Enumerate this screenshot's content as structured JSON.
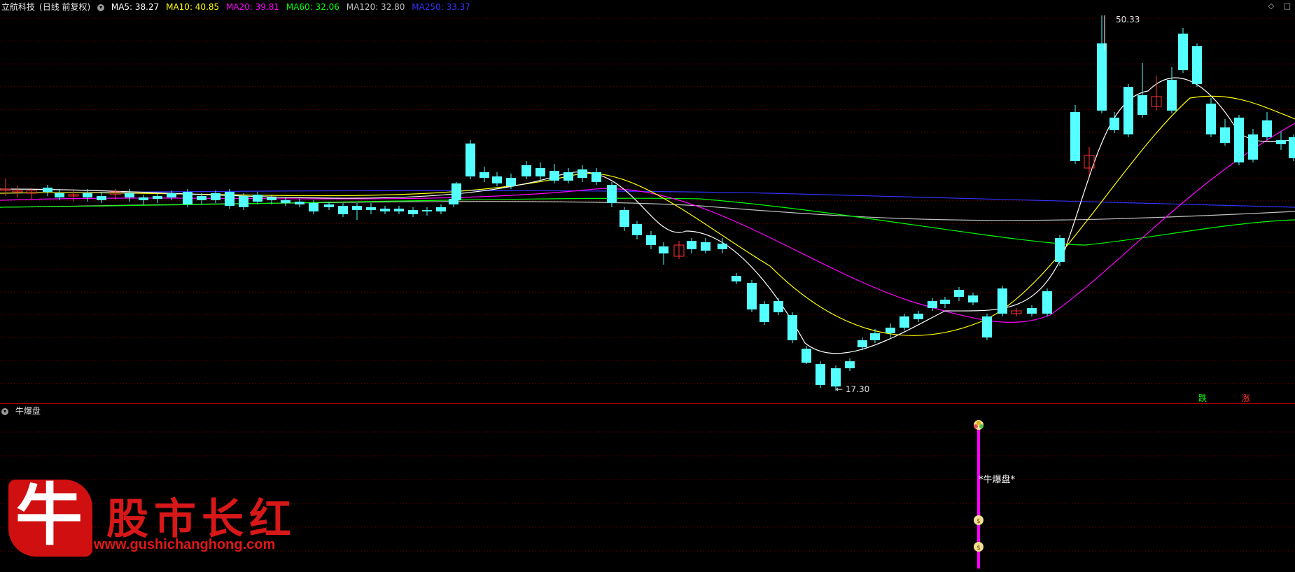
{
  "main_panel": {
    "stock_name": "立航科技",
    "period_label": "(日线 前复权)",
    "ma_indicators": [
      {
        "label": "MA5: 38.27",
        "color": "#ffffff"
      },
      {
        "label": "MA10: 40.85",
        "color": "#ffff00"
      },
      {
        "label": "MA20: 39.81",
        "color": "#ff00ff"
      },
      {
        "label": "MA60: 32.06",
        "color": "#00ff00"
      },
      {
        "label": "MA120: 32.80",
        "color": "#c0c0c0"
      },
      {
        "label": "MA250: 33.37",
        "color": "#3333ff"
      }
    ],
    "high_label": "50.33",
    "low_label": "17.30",
    "down_marker": "跌",
    "up_marker": "涨",
    "window_icons": [
      "diamond-icon",
      "square-icon"
    ]
  },
  "sub_panel": {
    "indicator_name": "牛爆盘",
    "signal_label": "*牛爆盘*"
  },
  "watermark": {
    "logo_char": "牛",
    "title": "股市长红",
    "url": "www.gushichanghong.com"
  },
  "colors": {
    "up_candle": "#ff3232",
    "down_candle": "#54ffff",
    "grid": "#7a0000",
    "ma5": "#ffffff",
    "ma10": "#ffff00",
    "ma20": "#ff00ff",
    "ma60": "#00ff00",
    "ma120": "#c0c0c0",
    "ma250": "#3333ff",
    "signal_line": "#ff00ff"
  }
}
